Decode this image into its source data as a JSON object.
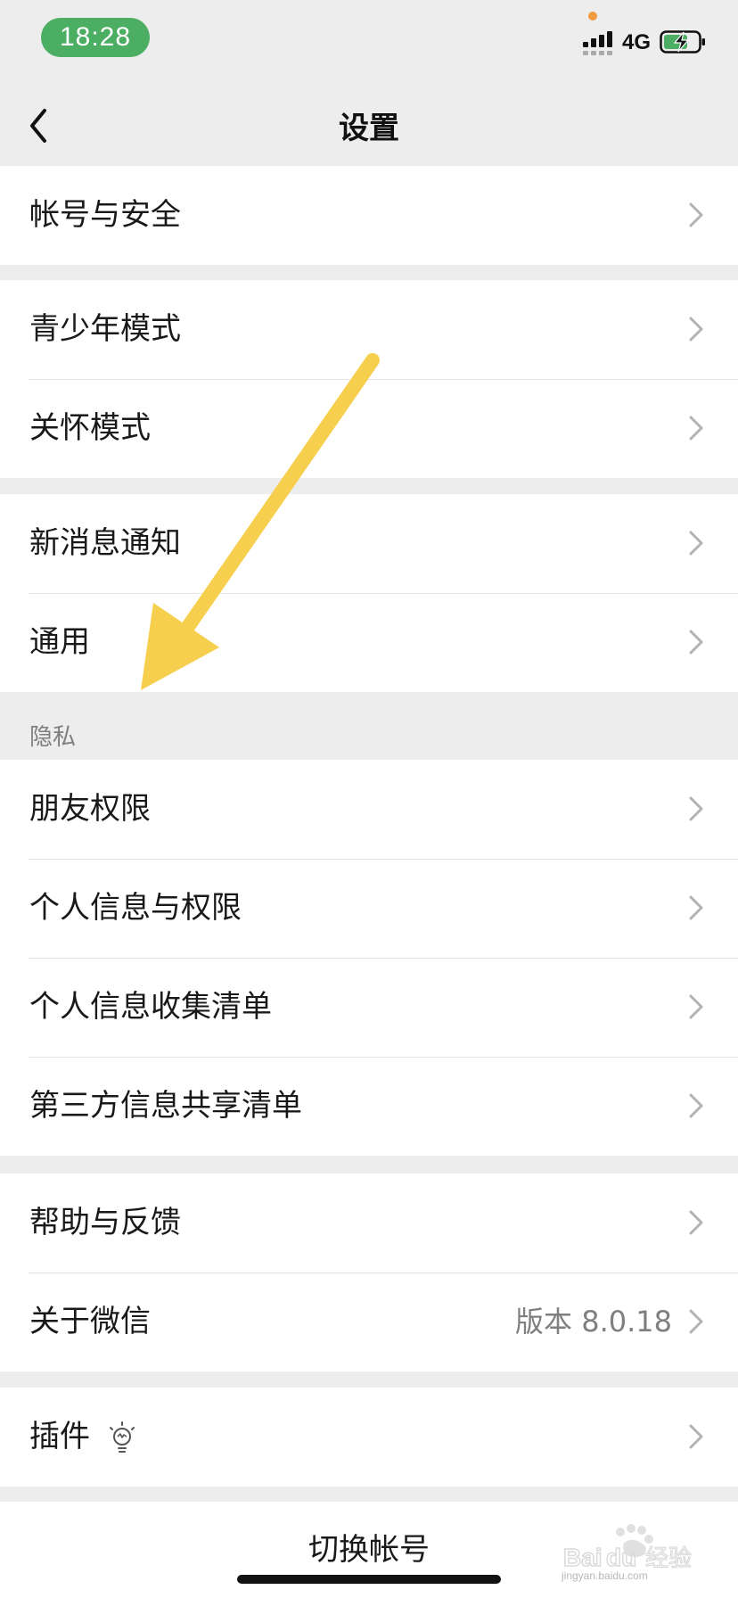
{
  "status_bar": {
    "time": "18:28",
    "network": "4G",
    "battery_color": "#4bae62",
    "time_bg": "#4bae62"
  },
  "nav": {
    "title": "设置"
  },
  "groups": [
    {
      "items": [
        {
          "label": "帐号与安全"
        }
      ]
    },
    {
      "items": [
        {
          "label": "青少年模式"
        },
        {
          "label": "关怀模式"
        }
      ]
    },
    {
      "items": [
        {
          "label": "新消息通知"
        },
        {
          "label": "通用"
        }
      ]
    },
    {
      "header": "隐私",
      "items": [
        {
          "label": "朋友权限"
        },
        {
          "label": "个人信息与权限"
        },
        {
          "label": "个人信息收集清单"
        },
        {
          "label": "第三方信息共享清单"
        }
      ]
    },
    {
      "items": [
        {
          "label": "帮助与反馈"
        },
        {
          "label": "关于微信",
          "value": "版本 8.0.18"
        }
      ]
    },
    {
      "items": [
        {
          "label": "插件",
          "icon": "lightbulb-icon"
        }
      ]
    }
  ],
  "bottom": {
    "switch_account": "切换帐号"
  },
  "annotation": {
    "color": "#f7cf4e",
    "icon": "arrow-pointer"
  },
  "watermark": {
    "brand": "Baidu经验",
    "site": "jingyan.baidu.com"
  }
}
